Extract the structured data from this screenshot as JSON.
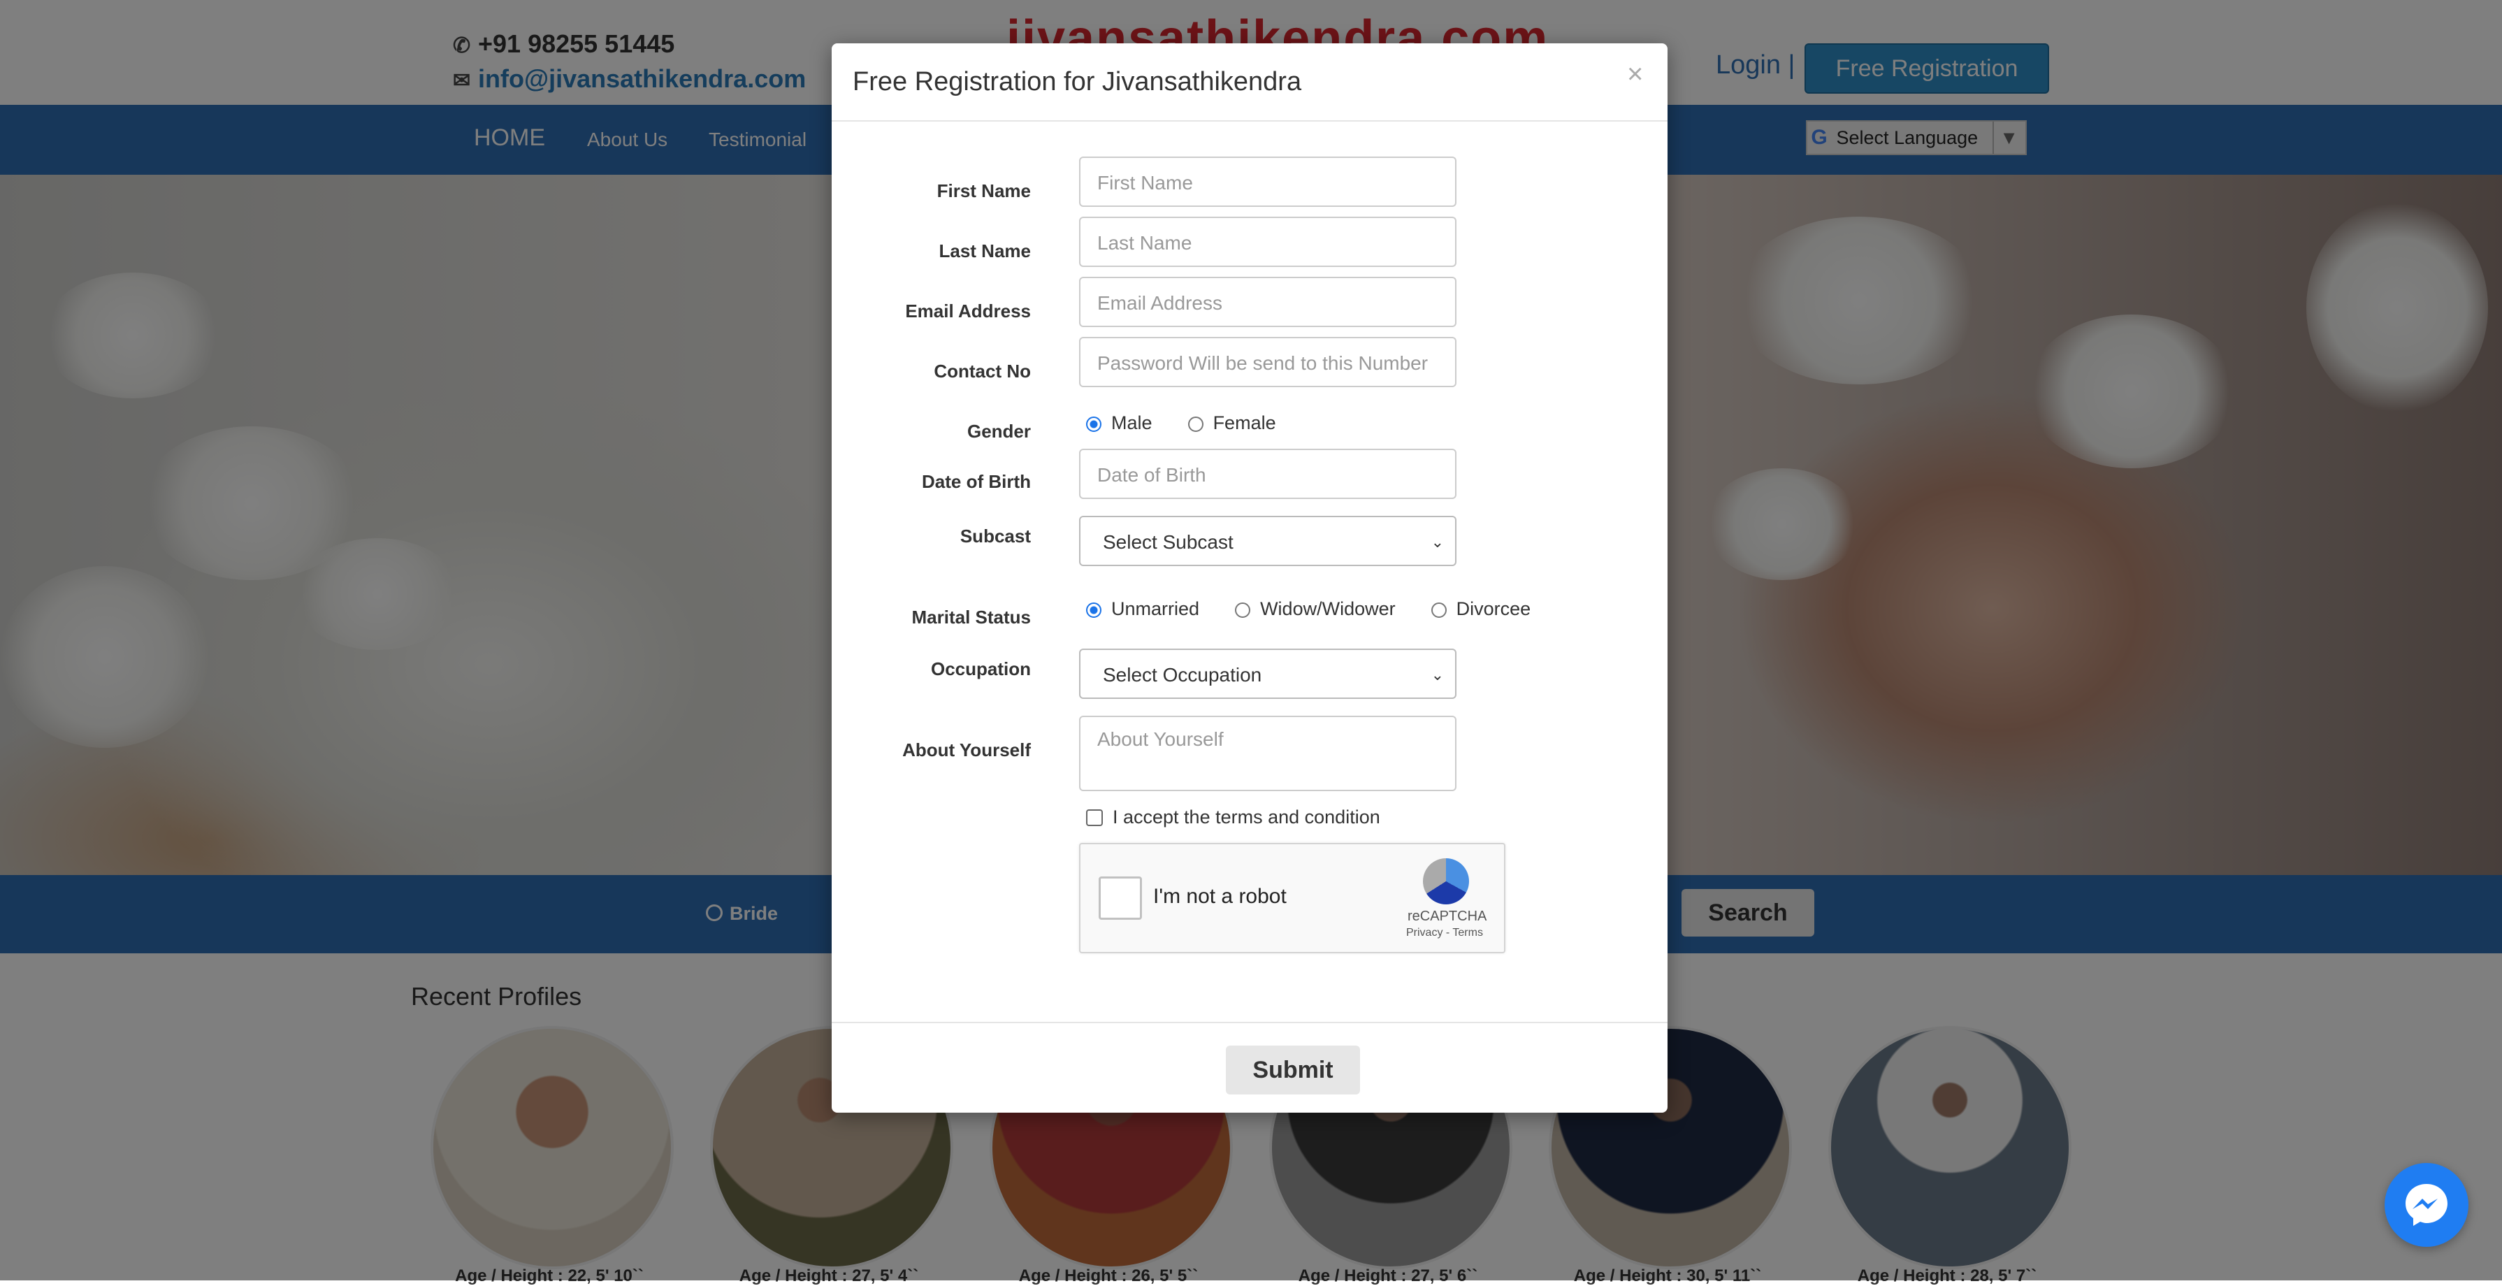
{
  "header": {
    "phone": "+91 98255 51445",
    "email": "info@jivansathikendra.com",
    "logo_text": "jivansathikendra.com",
    "login_label": "Login |",
    "free_registration_label": "Free Registration",
    "select_language_label": "Select Language"
  },
  "nav": {
    "items": [
      {
        "label": "HOME"
      },
      {
        "label": "About Us"
      },
      {
        "label": "Testimonial"
      }
    ]
  },
  "search": {
    "bride_label": "Bride",
    "search_label": "Search"
  },
  "profiles": {
    "title": "Recent Profiles",
    "captions": [
      "Age / Height : 22, 5' 10``",
      "Age / Height : 27, 5' 4``",
      "Age / Height : 26, 5' 5``",
      "Age / Height : 27, 5' 6``",
      "Age / Height : 30, 5' 11``",
      "Age / Height : 28, 5' 7``"
    ]
  },
  "modal": {
    "title": "Free Registration for Jivansathikendra",
    "close": "×",
    "first_name_label": "First Name",
    "first_name_placeholder": "First Name",
    "last_name_label": "Last Name",
    "last_name_placeholder": "Last Name",
    "email_label": "Email Address",
    "email_placeholder": "Email Address",
    "contact_label": "Contact No",
    "contact_placeholder": "Password Will be send to this Number",
    "gender_label": "Gender",
    "gender_options": [
      "Male",
      "Female"
    ],
    "gender_selected": "Male",
    "dob_label": "Date of Birth",
    "dob_placeholder": "Date of Birth",
    "subcast_label": "Subcast",
    "subcast_value": "Select Subcast",
    "marital_label": "Marital Status",
    "marital_options": [
      "Unmarried",
      "Widow/Widower",
      "Divorcee"
    ],
    "marital_selected": "Unmarried",
    "occupation_label": "Occupation",
    "occupation_value": "Select Occupation",
    "about_label": "About Yourself",
    "about_placeholder": "About Yourself",
    "terms_label": "I accept the terms and condition",
    "captcha_text": "I'm not a robot",
    "captcha_brand": "reCAPTCHA",
    "captcha_links": "Privacy - Terms",
    "submit_label": "Submit"
  },
  "colors": {
    "nav_blue": "#2e6eb5",
    "brand_red": "#d9272e",
    "link_blue": "#2a7ab8",
    "radio_blue": "#1a73e8",
    "messenger_blue": "#1f7df2"
  }
}
